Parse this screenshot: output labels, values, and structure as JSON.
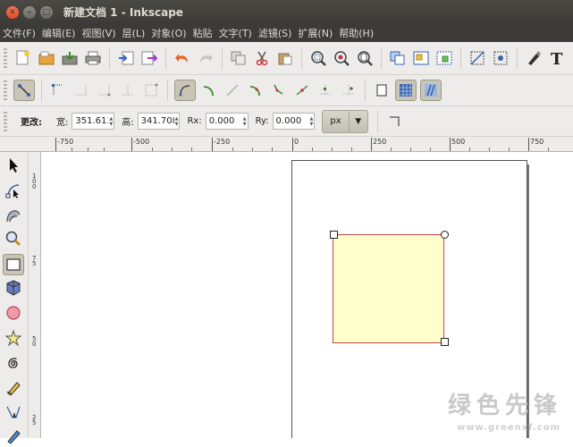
{
  "window": {
    "title": "新建文档 1 - Inkscape"
  },
  "menu": [
    "文件(F)",
    "编辑(E)",
    "视图(V)",
    "层(L)",
    "对象(O)",
    "粘贴",
    "文字(T)",
    "滤镜(S)",
    "扩展(N)",
    "帮助(H)"
  ],
  "toolbar_icons": {
    "main": [
      "new-document-icon",
      "open-icon",
      "save-icon",
      "print-icon",
      "import-icon",
      "export-icon",
      "undo-icon",
      "redo-icon",
      "duplicate-icon",
      "cut-icon",
      "paste-icon",
      "zoom-selection-icon",
      "zoom-drawing-icon",
      "zoom-page-icon",
      "copy-icon",
      "group-icon",
      "ungroup-icon",
      "node-edit-icon",
      "clone-icon",
      "pen-icon",
      "text-icon"
    ],
    "snap": [
      "snap-toggle-icon",
      "snap-node-icon",
      "snap-path-icon",
      "snap-midpoint-icon",
      "snap-center-icon",
      "snap-smooth-icon",
      "snap-cusp-icon",
      "snap-line-icon",
      "snap-intersection-icon",
      "snap-guide-icon",
      "snap-midpoint-small-icon",
      "snap-object-center-icon",
      "snap-page-icon",
      "snap-grid-icon",
      "snap-guide-lines-icon"
    ]
  },
  "tool_controls": {
    "change_label": "更改:",
    "width_label": "宽:",
    "width_value": "351.613",
    "height_label": "高:",
    "height_value": "341.708",
    "rx_label": "Rx:",
    "rx_value": "0.000",
    "ry_label": "Ry:",
    "ry_value": "0.000",
    "unit": "px"
  },
  "ruler": {
    "top_labels": [
      "-750",
      "-500",
      "-250",
      "0",
      "250",
      "500",
      "750"
    ],
    "left_labels": [
      "1 0 0",
      "7 5",
      "5 0",
      "2 5"
    ]
  },
  "tools": [
    "selector-tool-icon",
    "node-tool-icon",
    "tweak-tool-icon",
    "zoom-tool-icon",
    "rectangle-tool-icon",
    "3d-box-tool-icon",
    "ellipse-tool-icon",
    "star-tool-icon",
    "spiral-tool-icon",
    "pencil-tool-icon",
    "pen-tool-icon",
    "calligraphy-tool-icon"
  ],
  "watermark": {
    "text": "绿色先锋",
    "url": "www.greenxf.com"
  },
  "colors": {
    "rect_fill": "#ffffcc",
    "rect_stroke": "#c8424a",
    "titlebar": "#3c3b37"
  }
}
